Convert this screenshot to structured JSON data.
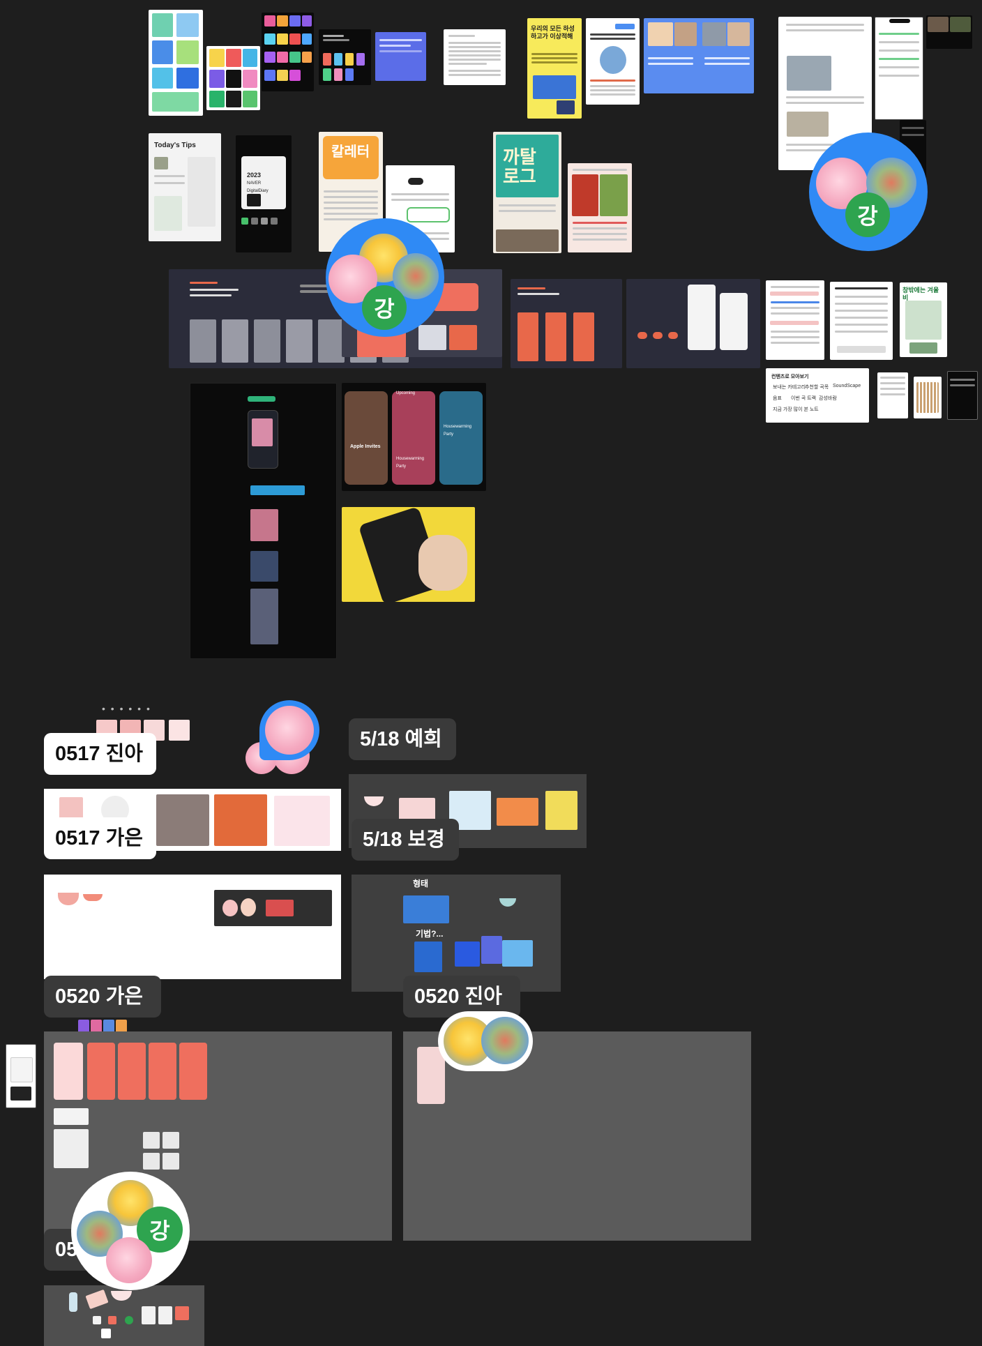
{
  "canvas": {
    "background": "#1e1e1e"
  },
  "thumb_text": {
    "todays_tips": "Today's Tips",
    "diary_year": "2023",
    "diary_title": "NAVER DigitalDiary",
    "poster_title": "까탈로그",
    "sticker_title": "칼레터",
    "apple_invites": "Apple Invites",
    "housewarming": "Housewarming Party",
    "housewarming_2": "Housewarming Party",
    "upcoming": "Upcoming",
    "form_label": "형태",
    "technique_label": "기법?...",
    "green_book": "창밖에는 겨울비",
    "contents_title": "컨텐츠로 모아보기",
    "chip_1": "보내는 카테고리",
    "chip_2": "추천할 곡목",
    "chip_3": "SoundScape",
    "chip_4": "음표",
    "chip_5": "이번 곡 트랙",
    "chip_6": "감성바람",
    "chip_7": "지금 가장 많이 본 노트",
    "yellow_card_title": "우리의 모든 하성하고가 이상적해",
    "tag_1": "Upcoming"
  },
  "labels": {
    "l0517_jina": "0517 진아",
    "l0517_gaeun": "0517 가은",
    "l518_yehee": "5/18 예희",
    "l518_bokyung": "5/18 보경",
    "l0520_gaeun": "0520 가은",
    "l0520_jina": "0520 진아",
    "l05_partial": "05"
  },
  "avatars": {
    "kang_initial": "강"
  },
  "dots": "• • • • • •",
  "colors": {
    "avatar_ring": "#2f8af5",
    "avatar_green": "#2ea44f",
    "label_bg": "#3a3a3a",
    "section_gray": "#5b5b5b",
    "accent_orange": "#e8684a",
    "accent_coral": "#ef6f5e"
  },
  "icons": [
    "pink-rabbit-avatar-icon",
    "chick-avatar-icon",
    "holo-avatar-icon",
    "green-kang-avatar-icon"
  ]
}
